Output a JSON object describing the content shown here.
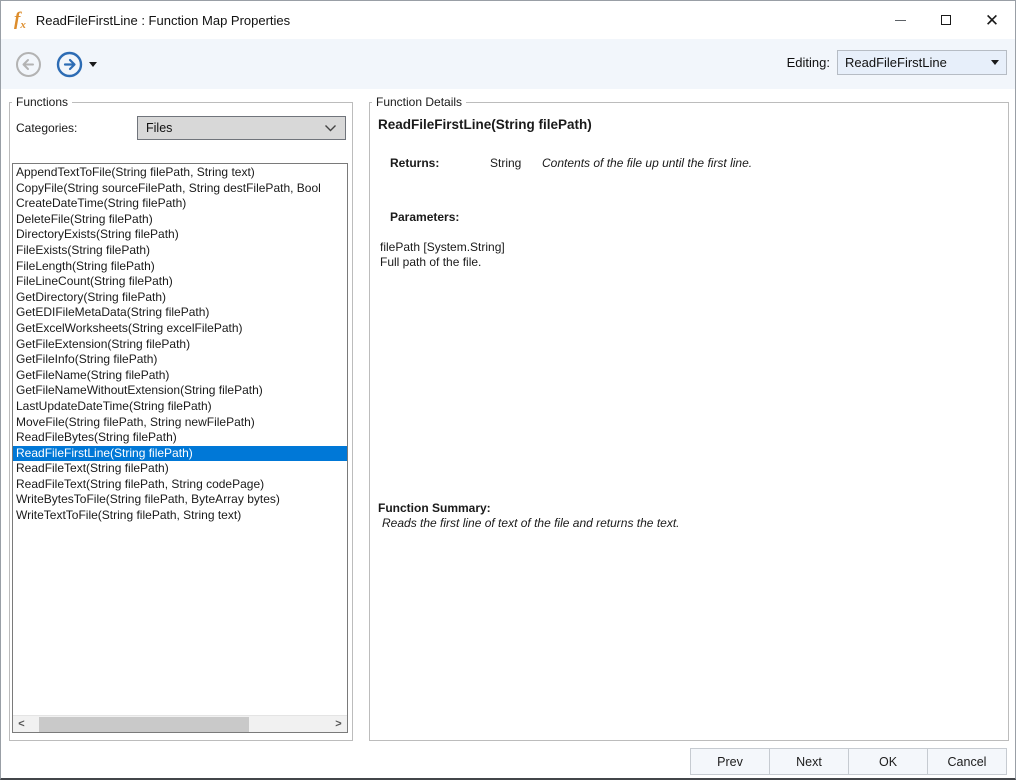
{
  "window": {
    "title": "ReadFileFirstLine : Function Map Properties",
    "icon": "fx"
  },
  "toolbar": {
    "editing_label": "Editing:",
    "editing_value": "ReadFileFirstLine"
  },
  "functions_panel": {
    "title": "Functions",
    "categories_label": "Categories:",
    "category_value": "Files",
    "selected_index": 18,
    "items": [
      "AppendTextToFile(String filePath, String text)",
      "CopyFile(String sourceFilePath, String destFilePath, Bool",
      "CreateDateTime(String filePath)",
      "DeleteFile(String filePath)",
      "DirectoryExists(String filePath)",
      "FileExists(String filePath)",
      "FileLength(String filePath)",
      "FileLineCount(String filePath)",
      "GetDirectory(String filePath)",
      "GetEDIFileMetaData(String filePath)",
      "GetExcelWorksheets(String excelFilePath)",
      "GetFileExtension(String filePath)",
      "GetFileInfo(String filePath)",
      "GetFileName(String filePath)",
      "GetFileNameWithoutExtension(String filePath)",
      "LastUpdateDateTime(String filePath)",
      "MoveFile(String filePath, String newFilePath)",
      "ReadFileBytes(String filePath)",
      "ReadFileFirstLine(String filePath)",
      "ReadFileText(String filePath)",
      "ReadFileText(String filePath, String codePage)",
      "WriteBytesToFile(String filePath, ByteArray bytes)",
      "WriteTextToFile(String filePath, String text)"
    ]
  },
  "details_panel": {
    "title": "Function Details",
    "header": "ReadFileFirstLine(String filePath)",
    "returns_label": "Returns:",
    "returns_type": "String",
    "returns_desc": "Contents of the file up until the first line.",
    "parameters_label": "Parameters:",
    "parameters": [
      {
        "name": "filePath [System.String]",
        "desc": "Full path of the file."
      }
    ],
    "summary_label": "Function Summary:",
    "summary": "Reads the first line of text of the file and returns the text."
  },
  "footer": {
    "buttons": [
      "Prev",
      "Next",
      "OK",
      "Cancel"
    ]
  },
  "colors": {
    "selection": "#0078d7",
    "accent_orange": "#dd8d2c",
    "forward_blue": "#2d6cb4",
    "back_gray": "#b3b3b3",
    "toolbar_bg": "#f2f6fb"
  }
}
